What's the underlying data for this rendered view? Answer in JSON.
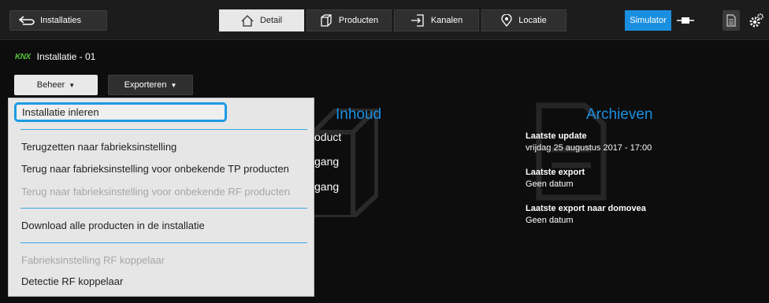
{
  "topbar": {
    "back_label": "Installaties",
    "tabs": [
      {
        "label": "Detail",
        "icon": "home-icon",
        "active": true
      },
      {
        "label": "Producten",
        "icon": "cube-icon",
        "active": false
      },
      {
        "label": "Kanalen",
        "icon": "channel-icon",
        "active": false
      },
      {
        "label": "Locatie",
        "icon": "location-pin-icon",
        "active": false
      }
    ],
    "simulator_label": "Simulator",
    "accent": "#1a8fe0"
  },
  "installation": {
    "logo": "KNX",
    "title": "Installatie - 01"
  },
  "actions": {
    "beheer_label": "Beheer",
    "exporteren_label": "Exporteren"
  },
  "menu": {
    "items": [
      {
        "label": "Installatie inleren",
        "enabled": true,
        "selected": true
      },
      {
        "label": "Terugzetten naar fabrieksinstelling",
        "enabled": true
      },
      {
        "label": "Terug naar fabrieksinstelling voor onbekende TP producten",
        "enabled": true
      },
      {
        "label": "Terug naar fabrieksinstelling voor onbekende RF producten",
        "enabled": false
      },
      {
        "label": "Download alle producten in de installatie",
        "enabled": true
      },
      {
        "label": "Fabrieksinstelling RF koppelaar",
        "enabled": false
      },
      {
        "label": "Detectie RF koppelaar",
        "enabled": true
      }
    ]
  },
  "inhoud": {
    "heading": "Inhoud",
    "items": [
      "oduct",
      "gang",
      "gang"
    ]
  },
  "archieven": {
    "heading": "Archieven",
    "last_update_label": "Laatste update",
    "last_update_value": "vrijdag 25 augustus 2017 - 17:00",
    "last_export_label": "Laatste export",
    "last_export_value": "Geen datum",
    "last_export_domovea_label": "Laatste export naar domovea",
    "last_export_domovea_value": "Geen datum"
  }
}
